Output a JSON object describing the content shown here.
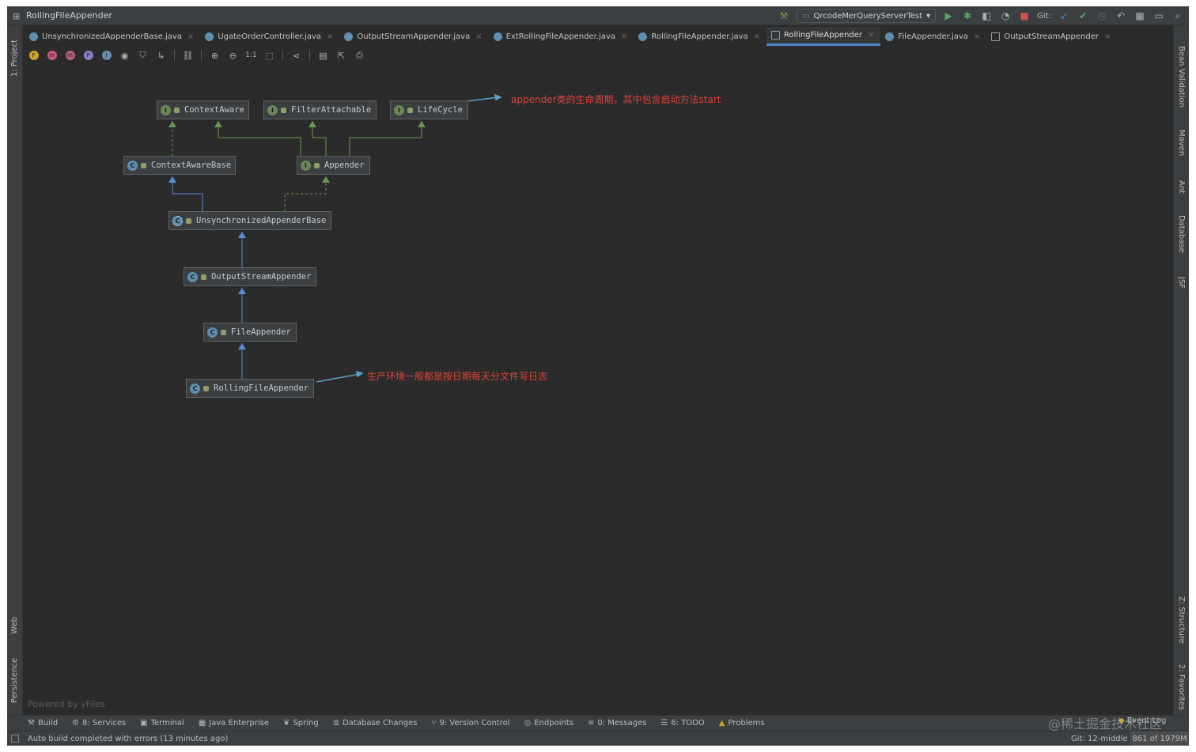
{
  "window": {
    "title": "RollingFileAppender"
  },
  "toolbar_right": {
    "run_config": "QrcodeMerQueryServerTest",
    "git_label": "Git:"
  },
  "tabs": [
    {
      "label": "UnsynchronizedAppenderBase.java",
      "icon": "class-icon",
      "active": false
    },
    {
      "label": "UgateOrderController.java",
      "icon": "class-icon",
      "active": false
    },
    {
      "label": "OutputStreamAppender.java",
      "icon": "class-icon",
      "active": false
    },
    {
      "label": "ExtRollingFileAppender.java",
      "icon": "class-icon",
      "active": false
    },
    {
      "label": "RollingFileAppender.java",
      "icon": "class-icon",
      "active": false
    },
    {
      "label": "RollingFileAppender",
      "icon": "diagram-icon",
      "active": true
    },
    {
      "label": "FileAppender.java",
      "icon": "class-icon",
      "active": false
    },
    {
      "label": "OutputStreamAppender",
      "icon": "diagram-icon",
      "active": false
    }
  ],
  "diagram_toolbar": {
    "fields_label": "F",
    "constructors_label": "m",
    "methods_label": "m",
    "properties_label": "P",
    "inner_label": "I",
    "one_to_one": "1:1"
  },
  "side_left": {
    "project": "1: Project",
    "web": "Web",
    "persistence": "Persistence"
  },
  "side_right": {
    "bean_validation": "Bean Validation",
    "maven": "Maven",
    "ant": "Ant",
    "database": "Database",
    "jsf": "JSF",
    "structure": "Z: Structure",
    "favorites": "2: Favorites"
  },
  "diagram": {
    "nodes": {
      "context_aware": {
        "label": "ContextAware",
        "kind": "I"
      },
      "filter_attachable": {
        "label": "FilterAttachable",
        "kind": "I"
      },
      "life_cycle": {
        "label": "LifeCycle",
        "kind": "I"
      },
      "context_aware_base": {
        "label": "ContextAwareBase",
        "kind": "C"
      },
      "appender": {
        "label": "Appender",
        "kind": "I"
      },
      "unsync_base": {
        "label": "UnsynchronizedAppenderBase",
        "kind": "C"
      },
      "output_stream": {
        "label": "OutputStreamAppender",
        "kind": "C"
      },
      "file_appender": {
        "label": "FileAppender",
        "kind": "C"
      },
      "rolling_file": {
        "label": "RollingFileAppender",
        "kind": "C"
      }
    },
    "notes": {
      "lifecycle": "appender类的生命周期，其中包含启动方法start",
      "rolling": "生产环境一般都是按日期每天分文件写日志"
    },
    "powered_by": "Powered by yFiles"
  },
  "bottom_tools": [
    {
      "label": "Build",
      "icon": "hammer-icon"
    },
    {
      "label": "8: Services",
      "icon": "services-icon"
    },
    {
      "label": "Terminal",
      "icon": "terminal-icon"
    },
    {
      "label": "Java Enterprise",
      "icon": "enterprise-icon"
    },
    {
      "label": "Spring",
      "icon": "spring-icon"
    },
    {
      "label": "Database Changes",
      "icon": "database-icon"
    },
    {
      "label": "9: Version Control",
      "icon": "vcs-icon"
    },
    {
      "label": "Endpoints",
      "icon": "endpoints-icon"
    },
    {
      "label": "0: Messages",
      "icon": "messages-icon"
    },
    {
      "label": "6: TODO",
      "icon": "todo-icon"
    },
    {
      "label": "Problems",
      "icon": "warning-icon"
    }
  ],
  "event_log": "Event Log",
  "status": {
    "message": "Auto build completed with errors (13 minutes ago)",
    "git_branch": "Git: 12-middle",
    "memory": "861 of 1979M"
  },
  "watermark": "@稀土掘金技术社区",
  "colors": {
    "accent": "#4a88c7",
    "note": "#e0433a",
    "interface_badge": "#6a8759",
    "class_badge": "#5f8fb0"
  }
}
